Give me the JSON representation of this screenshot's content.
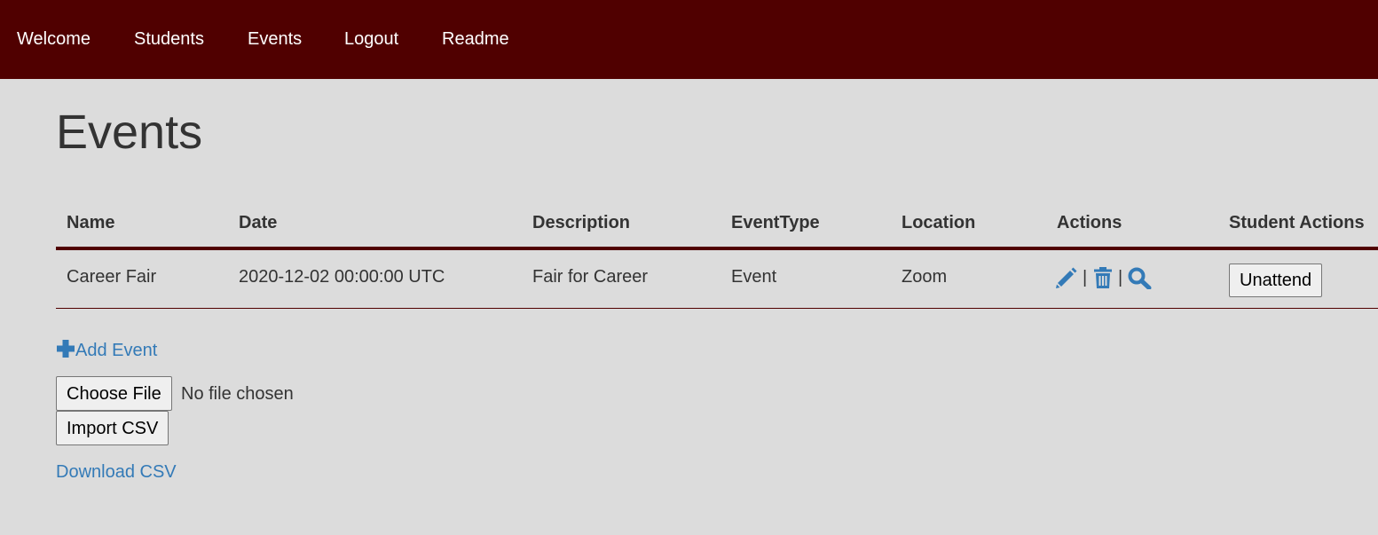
{
  "nav": {
    "items": [
      {
        "label": "Welcome"
      },
      {
        "label": "Students"
      },
      {
        "label": "Events"
      },
      {
        "label": "Logout"
      },
      {
        "label": "Readme"
      }
    ]
  },
  "page": {
    "title": "Events"
  },
  "table": {
    "columns": [
      "Name",
      "Date",
      "Description",
      "EventType",
      "Location",
      "Actions",
      "Student Actions"
    ],
    "rows": [
      {
        "name": "Career Fair",
        "date": "2020-12-02 00:00:00 UTC",
        "description": "Fair for Career",
        "event_type": "Event",
        "location": "Zoom",
        "actions": {
          "icons": [
            "pencil-icon",
            "trash-icon",
            "search-icon"
          ],
          "separator": "|"
        },
        "student_action_label": "Unattend"
      }
    ]
  },
  "add_event": {
    "icon": "plus-icon",
    "label": "Add Event"
  },
  "file_input": {
    "button_label": "Choose File",
    "status": "No file chosen"
  },
  "import_button_label": "Import CSV",
  "download_link_label": "Download CSV",
  "colors": {
    "navbar": "#500000",
    "background": "#dcdcdc",
    "link": "#337ab7",
    "text": "#333333"
  }
}
